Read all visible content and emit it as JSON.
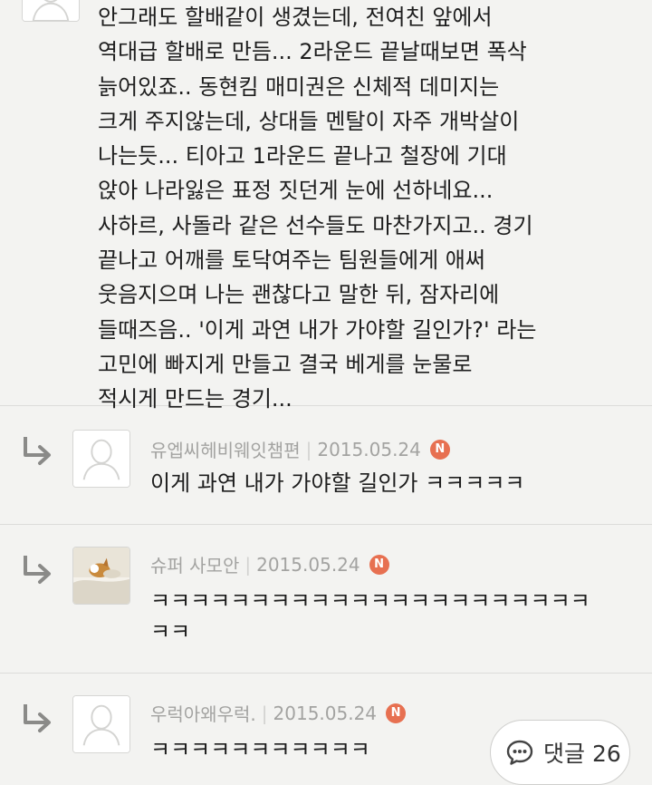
{
  "main_comment": {
    "lines": [
      "안그래도 할배같이 생겼는데, 전여친 앞에서",
      "역대급 할배로 만듬... 2라운드 끝날때보면 폭삭",
      "늙어있죠.. 동현킴 매미권은 신체적 데미지는",
      "크게 주지않는데, 상대들 멘탈이 자주 개박살이",
      "나는듯... 티아고 1라운드 끝나고 철장에 기대",
      "앉아 나라잃은 표정 짓던게 눈에 선하네요...",
      "사하르, 사돌라 같은 선수들도 마찬가지고.. 경기",
      "끝나고 어깨를 토닥여주는 팀원들에게 애써",
      "웃음지으며 나는 괜찮다고 말한 뒤, 잠자리에",
      "들때즈음.. '이게 과연 내가 가야할 길인가?' 라는",
      "고민에 빠지게 만들고 결국 베게를 눈물로",
      "적시게 만드는 경기..."
    ]
  },
  "replies": [
    {
      "author": "유엡씨헤비웨잇챔편",
      "date": "2015.05.24",
      "badge": "N",
      "lines": [
        "이게 과연 내가 가야할 길인가 ㅋㅋㅋㅋㅋ"
      ]
    },
    {
      "author": "슈퍼 사모안",
      "date": "2015.05.24",
      "badge": "N",
      "lines": [
        "ㅋㅋㅋㅋㅋㅋㅋㅋㅋㅋㅋㅋㅋㅋㅋㅋㅋㅋㅋㅋㅋㅋ",
        "ㅋㅋ"
      ]
    },
    {
      "author": "우럭아왜우럭.",
      "date": "2015.05.24",
      "badge": "N",
      "lines": [
        "ㅋㅋㅋㅋㅋㅋㅋㅋㅋㅋㅋ"
      ]
    }
  ],
  "comment_button": {
    "label": "댓글 26",
    "icon": "speech-bubble-icon"
  },
  "colors": {
    "background": "#f3f3f1",
    "meta_text": "#a3a3a1",
    "badge": "#e77051"
  }
}
